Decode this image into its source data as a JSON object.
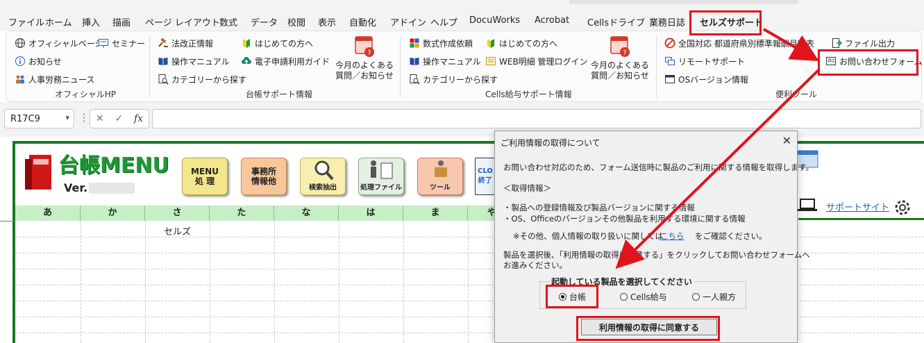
{
  "menu_tabs": [
    "ファイル",
    "ホーム",
    "挿入",
    "描画",
    "ページ レイアウト",
    "数式",
    "データ",
    "校閲",
    "表示",
    "自動化",
    "アドイン",
    "ヘルプ",
    "DocuWorks",
    "Acrobat",
    "Cellsドライブ",
    "業務日誌",
    "セルズサポート"
  ],
  "ribbon": {
    "official": {
      "items": [
        "オフィシャルページ",
        "セミナー",
        "お知らせ",
        "人事労務ニュース"
      ],
      "label": "オフィシャルHP"
    },
    "daicho": {
      "items": [
        "法改正情報",
        "はじめての方へ",
        "操作マニュアル",
        "電子申請利用ガイド",
        "カテゴリーから探す"
      ],
      "big": "今月のよくある\n質問／お知らせ",
      "label": "台帳サポート情報"
    },
    "cells": {
      "items": [
        "数式作成依頼",
        "はじめての方へ",
        "操作マニュアル",
        "WEB明細 管理ログイン",
        "カテゴリーから探す"
      ],
      "big": "今月のよくある\n質問／お知らせ",
      "label": "Cells給与サポート情報"
    },
    "tools": {
      "items": [
        "全国対応 都道府県別標準報酬月額表",
        "ファイル出力",
        "リモートサポート",
        "お問い合わせフォーム",
        "OSバージョン情報"
      ],
      "label": "便利ツール"
    }
  },
  "formula_bar": {
    "name_box": "R17C9",
    "fx": "fx",
    "cancel": "✕",
    "enter": "✓"
  },
  "sheet": {
    "app_title": "台帳MENU",
    "version_label": "Ver.",
    "buttons": [
      "MENU\n処 理",
      "事務所\n情報他",
      "検索抽出",
      "処理ファイル",
      "ツール",
      "CLO\n終了"
    ],
    "columns": [
      "あ",
      "か",
      "さ",
      "た",
      "な",
      "は",
      "ま",
      "や"
    ],
    "cell_value": "セルズ",
    "support_link": "サポートサイト"
  },
  "dialog": {
    "title": "ご利用情報の取得について",
    "close": "✕",
    "line1": "お問い合わせ対応のため、フォーム送信時に製品のご利用に関する情報を取得します。",
    "heading": "＜取得情報＞",
    "item1": "・製品への登録情報及び製品バージョンに関する情報",
    "item2": "・OS、Officeのバージョンその他製品を利用する環境に関する情報",
    "note_pre": "※その他、個人情報の取り扱いに関しては",
    "note_link": "こちら",
    "note_post": "をご確認ください。",
    "instr1": "製品を選択後、「利用情報の取得に同意する」をクリックしてお問い合わせフォームへ",
    "instr2": "お進みください。",
    "group_label": "起動している製品を選択してください",
    "options": [
      {
        "label": "台帳",
        "selected": true
      },
      {
        "label": "Cells給与",
        "selected": false
      },
      {
        "label": "一人親方",
        "selected": false
      }
    ],
    "agree": "利用情報の取得に同意する"
  },
  "colors": {
    "accent_red": "#e0141c",
    "frame_green": "#1a7a1a",
    "header_green": "#c6efc6"
  }
}
